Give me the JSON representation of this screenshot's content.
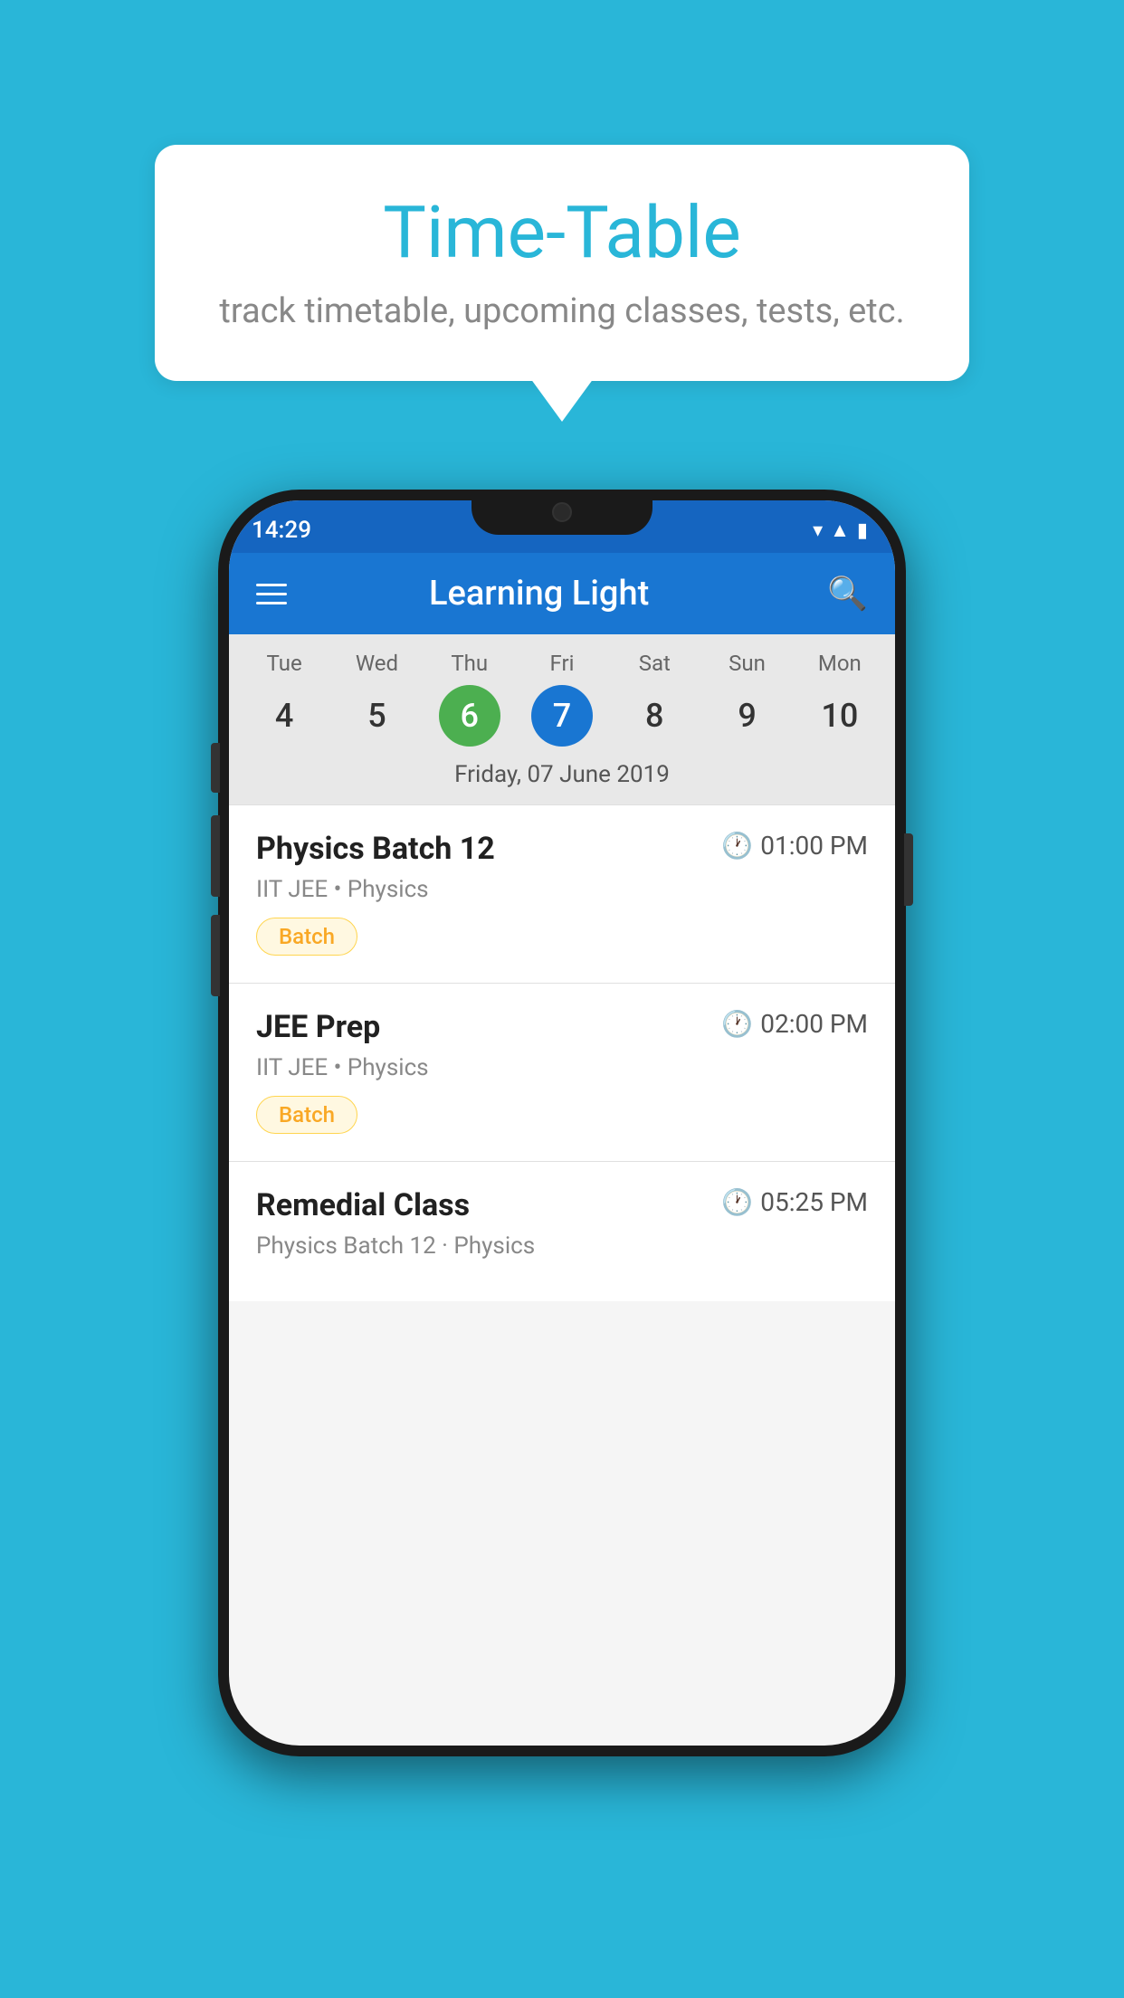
{
  "background_color": "#29B6D8",
  "bubble": {
    "title": "Time-Table",
    "subtitle": "track timetable, upcoming classes, tests, etc."
  },
  "phone": {
    "status_bar": {
      "time": "14:29"
    },
    "app_bar": {
      "title": "Learning Light"
    },
    "calendar": {
      "days": [
        {
          "label": "Tue",
          "num": "4",
          "state": "normal"
        },
        {
          "label": "Wed",
          "num": "5",
          "state": "normal"
        },
        {
          "label": "Thu",
          "num": "6",
          "state": "today"
        },
        {
          "label": "Fri",
          "num": "7",
          "state": "selected"
        },
        {
          "label": "Sat",
          "num": "8",
          "state": "normal"
        },
        {
          "label": "Sun",
          "num": "9",
          "state": "normal"
        },
        {
          "label": "Mon",
          "num": "10",
          "state": "normal"
        }
      ],
      "selected_date": "Friday, 07 June 2019"
    },
    "classes": [
      {
        "name": "Physics Batch 12",
        "time": "01:00 PM",
        "meta": "IIT JEE • Physics",
        "badge": "Batch"
      },
      {
        "name": "JEE Prep",
        "time": "02:00 PM",
        "meta": "IIT JEE • Physics",
        "badge": "Batch"
      },
      {
        "name": "Remedial Class",
        "time": "05:25 PM",
        "meta": "Physics Batch 12 · Physics",
        "badge": null
      }
    ]
  }
}
